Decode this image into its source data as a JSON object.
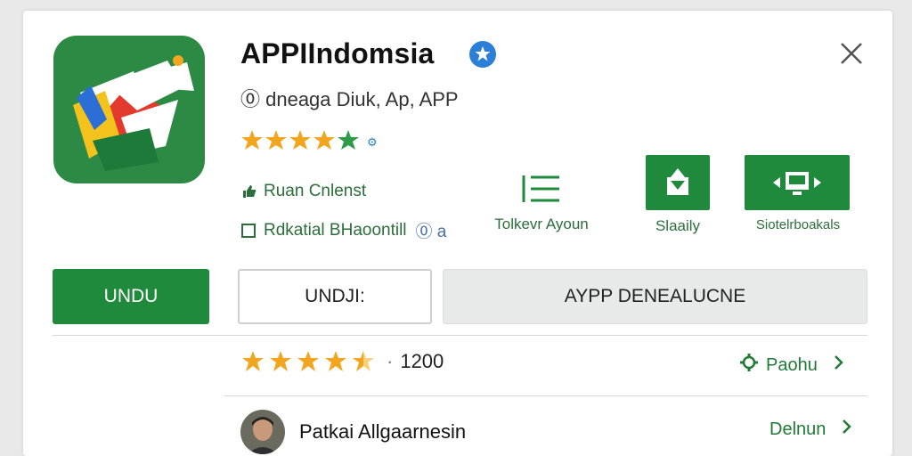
{
  "app": {
    "title": "APPIIndomsia",
    "subtitle": "⓪ dneaga Diuk, Ap, APP",
    "icon": "app-logo-icon"
  },
  "info": {
    "line1": "Ruan Cnlenst",
    "line2": "Rdkatial BHaoontill",
    "line2_suffix": "⓪ a"
  },
  "actions": [
    {
      "label": "Tolkevr Ayoun",
      "icon": "list-icon"
    },
    {
      "label": "Slaaily",
      "icon": "download-tray-icon"
    },
    {
      "label": "Siotelrboakals",
      "icon": "screen-share-icon"
    }
  ],
  "buttons": {
    "primary": "UNDU",
    "secondary": "UNDJI:",
    "tertiary": "AYPP DENEALUCNE"
  },
  "rating": {
    "stars": 4.5,
    "separator": "·",
    "count": "1200"
  },
  "links": {
    "rating_link": "Paohu",
    "reviewer_link": "Delnun"
  },
  "reviewer": {
    "name": "Patkai Allgaarnesin"
  },
  "colors": {
    "green": "#1f8a3b",
    "star": "#f2a51f",
    "verified": "#2b7fd6"
  }
}
